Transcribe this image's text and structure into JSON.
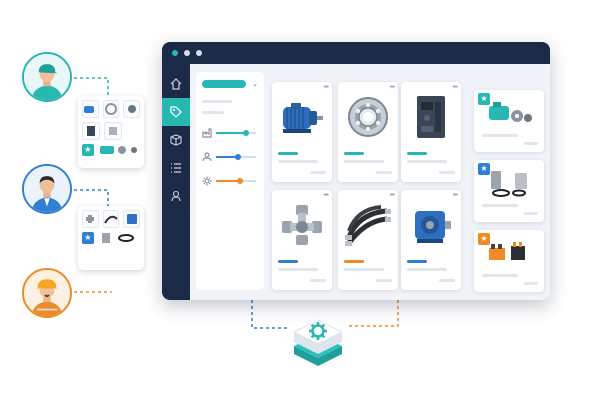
{
  "colors": {
    "navy": "#1b2a47",
    "teal": "#27b8b4",
    "blue": "#2f7fd4",
    "orange": "#f08a24",
    "panel_bg": "#f0f3f7"
  },
  "personas": [
    {
      "role": "technician",
      "ring": "#27b8b4",
      "icon": "worker-cap-icon"
    },
    {
      "role": "office-user",
      "ring": "#2f7fd4",
      "icon": "businessman-icon"
    },
    {
      "role": "site-worker",
      "ring": "#f08a24",
      "icon": "hardhat-worker-icon"
    }
  ],
  "window": {
    "controls": [
      "#27b8b4",
      "#d6dde6",
      "#d6dde6"
    ],
    "nav_icons": [
      "home-icon",
      "tag-icon",
      "box-icon",
      "list-icon",
      "user-icon"
    ],
    "active_nav": 1
  },
  "filters": [
    {
      "icon": "factory-icon",
      "color": "#27b8b4",
      "level": 0.75
    },
    {
      "icon": "person-icon",
      "color": "#2f7fd4",
      "level": 0.55
    },
    {
      "icon": "gear-icon",
      "color": "#f08a24",
      "level": 0.6
    }
  ],
  "products": [
    {
      "name": "electric-motor",
      "accent": "#27b8b4"
    },
    {
      "name": "ball-bearing",
      "accent": "#27b8b4"
    },
    {
      "name": "motor-drive",
      "accent": "#27b8b4"
    },
    {
      "name": "pipe-fitting",
      "accent": "#2f7fd4"
    },
    {
      "name": "hydraulic-hoses",
      "accent": "#f08a24"
    },
    {
      "name": "gear-reducer",
      "accent": "#2f7fd4"
    }
  ],
  "recommendations": [
    {
      "badge": "#27b8b4",
      "name": "motor-bundle"
    },
    {
      "badge": "#2f7fd4",
      "name": "bushing-set"
    },
    {
      "badge": "#f08a24",
      "name": "connector-kit"
    }
  ],
  "hub_icon": "gear-icon"
}
